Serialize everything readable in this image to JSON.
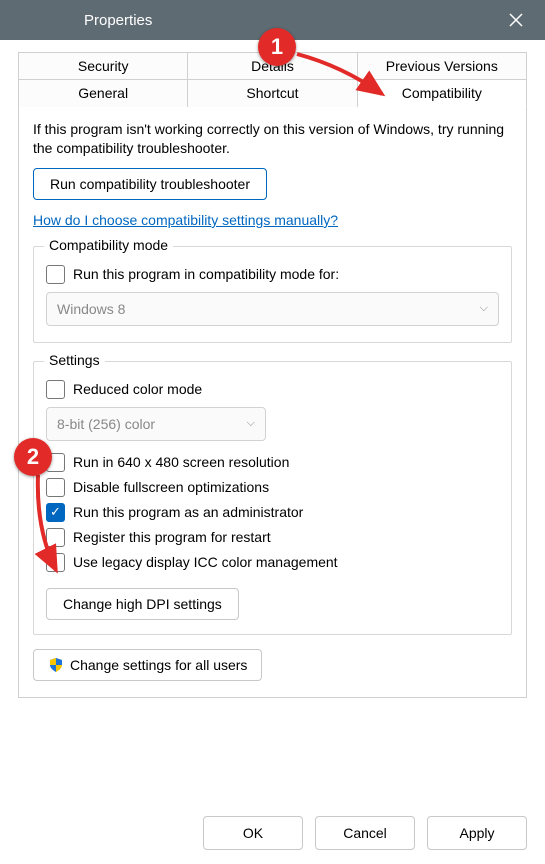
{
  "window": {
    "title": "Properties"
  },
  "tabs": {
    "row1": [
      "Security",
      "Details",
      "Previous Versions"
    ],
    "row2": [
      "General",
      "Shortcut",
      "Compatibility"
    ],
    "active": "Compatibility"
  },
  "intro": "If this program isn't working correctly on this version of Windows, try running the compatibility troubleshooter.",
  "troubleshoot_btn": "Run compatibility troubleshooter",
  "help_link": "How do I choose compatibility settings manually?",
  "compat_group": {
    "title": "Compatibility mode",
    "check_label": "Run this program in compatibility mode for:",
    "select_value": "Windows 8"
  },
  "settings_group": {
    "title": "Settings",
    "reduced_color": "Reduced color mode",
    "color_select": "8-bit (256) color",
    "run_640": "Run in 640 x 480 screen resolution",
    "disable_fs": "Disable fullscreen optimizations",
    "run_admin": "Run this program as an administrator",
    "register_restart": "Register this program for restart",
    "legacy_icc": "Use legacy display ICC color management",
    "dpi_btn": "Change high DPI settings"
  },
  "all_users_btn": "Change settings for all users",
  "footer": {
    "ok": "OK",
    "cancel": "Cancel",
    "apply": "Apply"
  },
  "markers": {
    "one": "1",
    "two": "2"
  }
}
